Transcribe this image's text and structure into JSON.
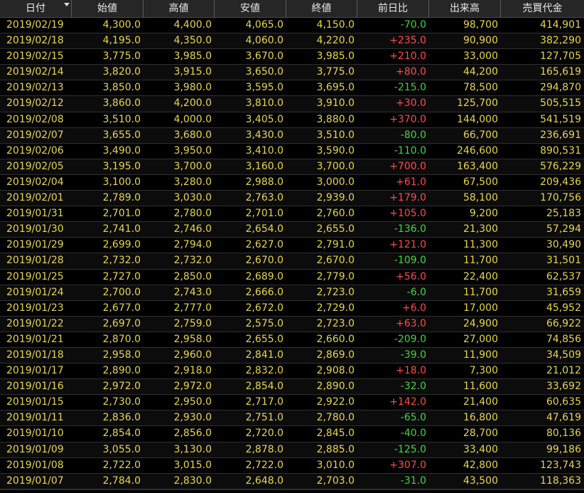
{
  "colors": {
    "text": "#e8d648",
    "up": "#ff4a4a",
    "down": "#3fd63f",
    "header_bg": "#262626",
    "bg": "#000000"
  },
  "columns": [
    "日付",
    "始値",
    "高値",
    "安値",
    "終値",
    "前日比",
    "出来高",
    "売買代金"
  ],
  "sort_indicator_icon": "sort-desc-triangle",
  "rows": [
    [
      "2019/02/19",
      "4,300.0",
      "4,400.0",
      "4,065.0",
      "4,150.0",
      "-70.0",
      "98,700",
      "414,901"
    ],
    [
      "2019/02/18",
      "4,195.0",
      "4,350.0",
      "4,060.0",
      "4,220.0",
      "+235.0",
      "90,900",
      "382,290"
    ],
    [
      "2019/02/15",
      "3,775.0",
      "3,985.0",
      "3,670.0",
      "3,985.0",
      "+210.0",
      "33,000",
      "127,705"
    ],
    [
      "2019/02/14",
      "3,820.0",
      "3,915.0",
      "3,650.0",
      "3,775.0",
      "+80.0",
      "44,200",
      "165,619"
    ],
    [
      "2019/02/13",
      "3,850.0",
      "3,980.0",
      "3,595.0",
      "3,695.0",
      "-215.0",
      "78,500",
      "294,870"
    ],
    [
      "2019/02/12",
      "3,860.0",
      "4,200.0",
      "3,810.0",
      "3,910.0",
      "+30.0",
      "125,700",
      "505,515"
    ],
    [
      "2019/02/08",
      "3,510.0",
      "4,000.0",
      "3,405.0",
      "3,880.0",
      "+370.0",
      "144,000",
      "541,519"
    ],
    [
      "2019/02/07",
      "3,655.0",
      "3,680.0",
      "3,430.0",
      "3,510.0",
      "-80.0",
      "66,700",
      "236,691"
    ],
    [
      "2019/02/06",
      "3,490.0",
      "3,950.0",
      "3,410.0",
      "3,590.0",
      "-110.0",
      "246,600",
      "890,531"
    ],
    [
      "2019/02/05",
      "3,195.0",
      "3,700.0",
      "3,160.0",
      "3,700.0",
      "+700.0",
      "163,400",
      "576,229"
    ],
    [
      "2019/02/04",
      "3,100.0",
      "3,280.0",
      "2,988.0",
      "3,000.0",
      "+61.0",
      "67,500",
      "209,436"
    ],
    [
      "2019/02/01",
      "2,789.0",
      "3,030.0",
      "2,763.0",
      "2,939.0",
      "+179.0",
      "58,100",
      "170,756"
    ],
    [
      "2019/01/31",
      "2,701.0",
      "2,780.0",
      "2,701.0",
      "2,760.0",
      "+105.0",
      "9,200",
      "25,183"
    ],
    [
      "2019/01/30",
      "2,741.0",
      "2,746.0",
      "2,654.0",
      "2,655.0",
      "-136.0",
      "21,300",
      "57,294"
    ],
    [
      "2019/01/29",
      "2,699.0",
      "2,794.0",
      "2,627.0",
      "2,791.0",
      "+121.0",
      "11,300",
      "30,490"
    ],
    [
      "2019/01/28",
      "2,732.0",
      "2,732.0",
      "2,670.0",
      "2,670.0",
      "-109.0",
      "11,700",
      "31,501"
    ],
    [
      "2019/01/25",
      "2,727.0",
      "2,850.0",
      "2,689.0",
      "2,779.0",
      "+56.0",
      "22,400",
      "62,537"
    ],
    [
      "2019/01/24",
      "2,700.0",
      "2,743.0",
      "2,666.0",
      "2,723.0",
      "-6.0",
      "11,700",
      "31,659"
    ],
    [
      "2019/01/23",
      "2,677.0",
      "2,777.0",
      "2,672.0",
      "2,729.0",
      "+6.0",
      "17,000",
      "45,952"
    ],
    [
      "2019/01/22",
      "2,697.0",
      "2,759.0",
      "2,575.0",
      "2,723.0",
      "+63.0",
      "24,900",
      "66,922"
    ],
    [
      "2019/01/21",
      "2,870.0",
      "2,958.0",
      "2,655.0",
      "2,660.0",
      "-209.0",
      "27,000",
      "74,856"
    ],
    [
      "2019/01/18",
      "2,958.0",
      "2,960.0",
      "2,841.0",
      "2,869.0",
      "-39.0",
      "11,900",
      "34,509"
    ],
    [
      "2019/01/17",
      "2,890.0",
      "2,918.0",
      "2,832.0",
      "2,908.0",
      "+18.0",
      "7,300",
      "21,012"
    ],
    [
      "2019/01/16",
      "2,972.0",
      "2,972.0",
      "2,854.0",
      "2,890.0",
      "-32.0",
      "11,600",
      "33,692"
    ],
    [
      "2019/01/15",
      "2,730.0",
      "2,950.0",
      "2,717.0",
      "2,922.0",
      "+142.0",
      "21,400",
      "60,635"
    ],
    [
      "2019/01/11",
      "2,836.0",
      "2,930.0",
      "2,751.0",
      "2,780.0",
      "-65.0",
      "16,800",
      "47,619"
    ],
    [
      "2019/01/10",
      "2,854.0",
      "2,856.0",
      "2,720.0",
      "2,845.0",
      "-40.0",
      "28,700",
      "80,136"
    ],
    [
      "2019/01/09",
      "3,055.0",
      "3,130.0",
      "2,878.0",
      "2,885.0",
      "-125.0",
      "33,400",
      "99,186"
    ],
    [
      "2019/01/08",
      "2,722.0",
      "3,015.0",
      "2,722.0",
      "3,010.0",
      "+307.0",
      "42,800",
      "123,743"
    ],
    [
      "2019/01/07",
      "2,784.0",
      "2,830.0",
      "2,648.0",
      "2,703.0",
      "-31.0",
      "43,500",
      "118,363"
    ]
  ]
}
